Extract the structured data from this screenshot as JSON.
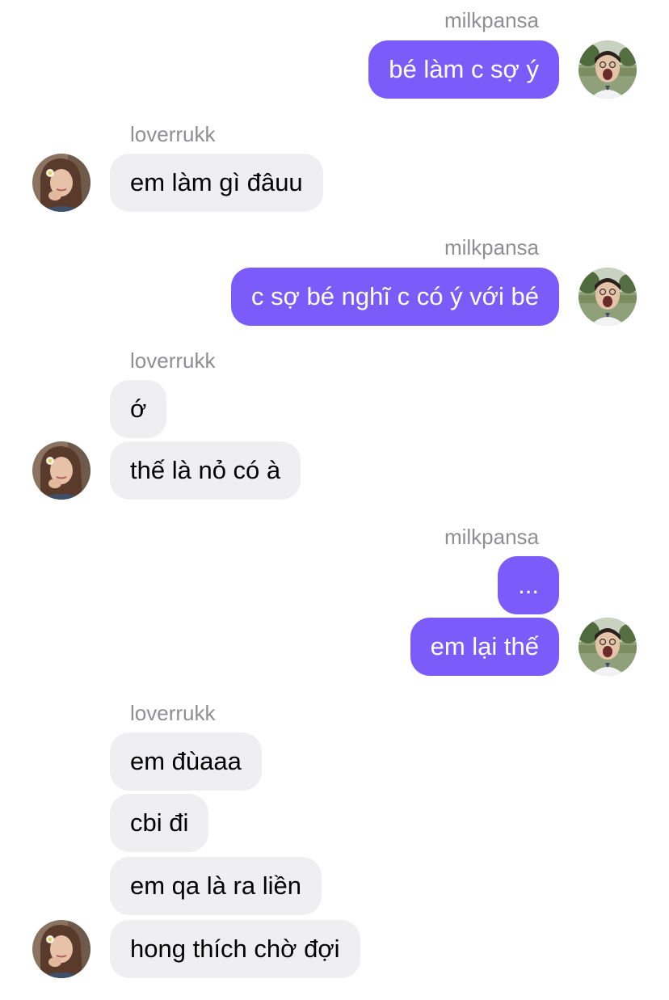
{
  "colors": {
    "outgoing_bubble": "#7b5cfa",
    "incoming_bubble": "#efeff1",
    "sender_label": "#8e8e93"
  },
  "participants": {
    "me": {
      "username": "milkpansa",
      "avatar_icon": "photo-avatar-outdoor"
    },
    "them": {
      "username": "loverrukk",
      "avatar_icon": "photo-avatar-girl"
    }
  },
  "groups": [
    {
      "side": "out",
      "sender": "milkpansa",
      "messages": [
        "bé làm c sợ ý"
      ]
    },
    {
      "side": "in",
      "sender": "loverrukk",
      "messages": [
        "em làm gì đâuu"
      ]
    },
    {
      "side": "out",
      "sender": "milkpansa",
      "messages": [
        "c sợ bé nghĩ c có ý với bé"
      ]
    },
    {
      "side": "in",
      "sender": "loverrukk",
      "messages": [
        "ớ",
        "thế là nỏ có à"
      ]
    },
    {
      "side": "out",
      "sender": "milkpansa",
      "messages": [
        "...",
        "em lại thế"
      ]
    },
    {
      "side": "in",
      "sender": "loverrukk",
      "messages": [
        "em đùaaa",
        "cbi đi",
        "em qa là ra liền",
        "hong thích chờ đợi"
      ]
    }
  ]
}
